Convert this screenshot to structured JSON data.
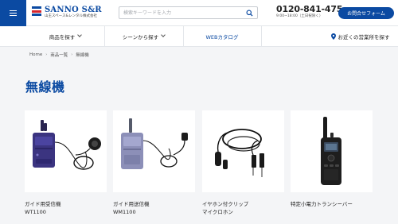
{
  "header": {
    "logo_name": "SANNO S&R",
    "logo_sub": "山王スペース&レンタル株式会社",
    "search_placeholder": "検索キーワードを入力",
    "phone": "0120-841-475",
    "hours": "9:00~18:00（土日祝除く）",
    "contact_label": "お問合せフォーム"
  },
  "nav": {
    "items": [
      {
        "label": "商品を探す"
      },
      {
        "label": "シーンから探す"
      },
      {
        "label": "WEBカタログ"
      },
      {
        "label": "お近くの営業所を探す"
      }
    ]
  },
  "breadcrumb": [
    "Home",
    "商品一覧",
    "無線機"
  ],
  "page_title": "無線機",
  "products": [
    {
      "name_line1": "ガイド用受信機",
      "name_line2": "WT1100"
    },
    {
      "name_line1": "ガイド用送信機",
      "name_line2": "WM1100"
    },
    {
      "name_line1": "イヤホン付クリップ",
      "name_line2": "マイクロホン"
    },
    {
      "name_line1": "特定小電力トランシーバー",
      "name_line2": ""
    }
  ],
  "colors": {
    "brand": "#0b4aa2",
    "logo_red": "#d7252c"
  }
}
